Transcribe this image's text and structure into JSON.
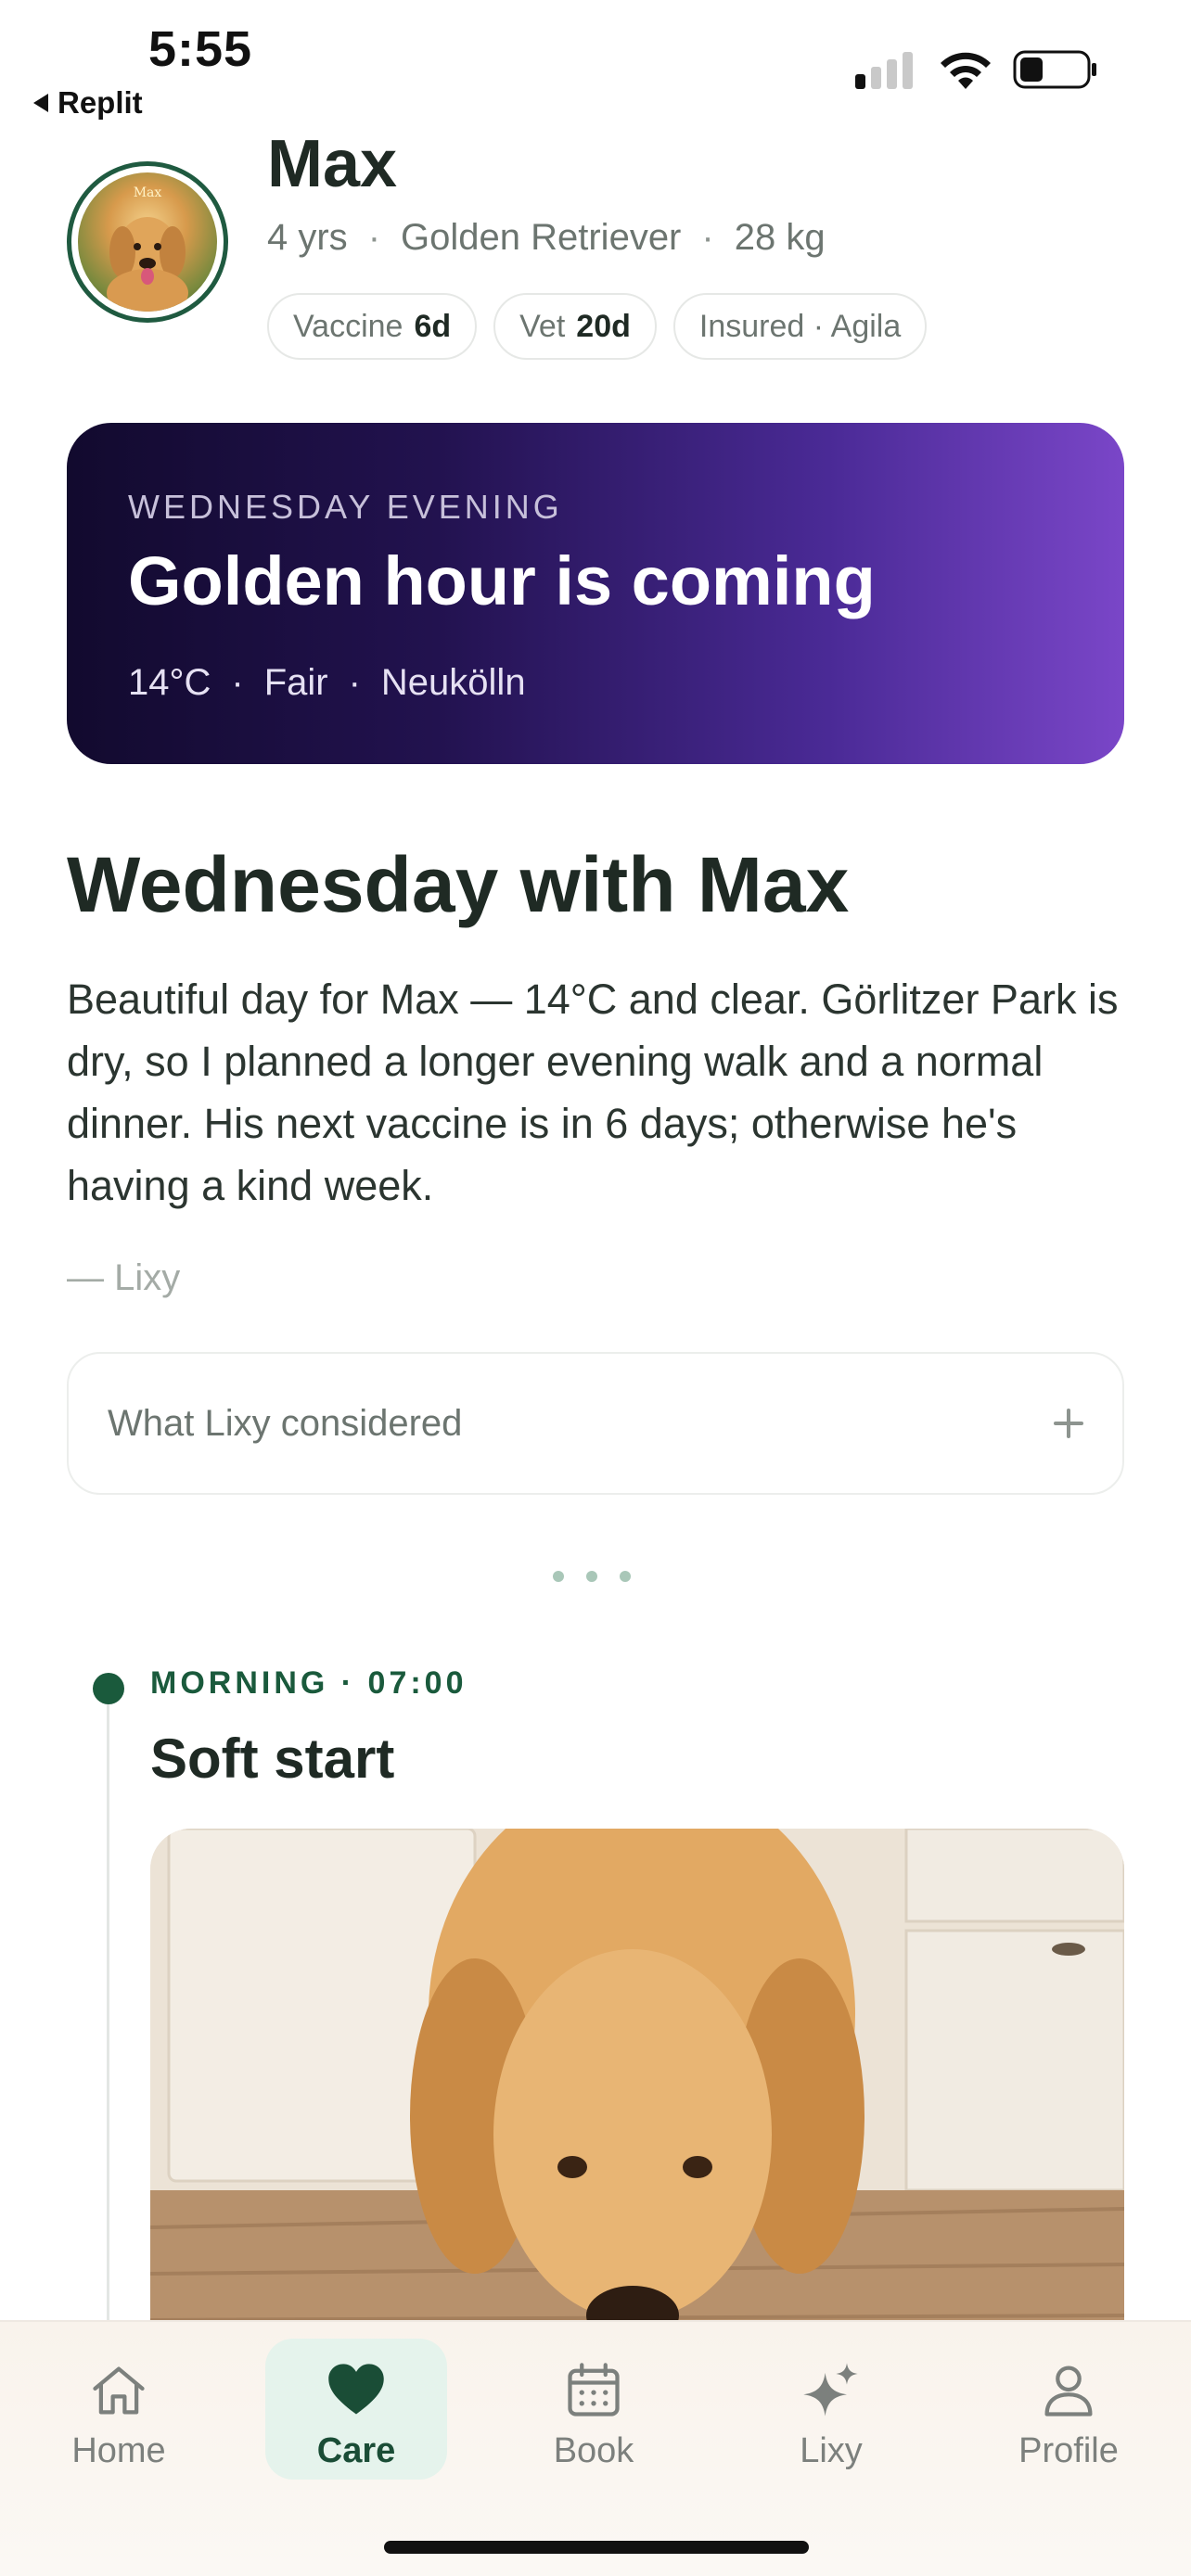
{
  "status_bar": {
    "time": "5:55",
    "back_app": "Replit",
    "signal_bars_active": 1,
    "battery_level": 0.35
  },
  "pet": {
    "name": "Max",
    "avatar_caption": "Max",
    "age": "4 yrs",
    "breed": "Golden Retriever",
    "weight": "28 kg",
    "separator": "·"
  },
  "chips": [
    {
      "label": "Vaccine",
      "value": "6d"
    },
    {
      "label": "Vet",
      "value": "20d"
    },
    {
      "label": "Insured · Agila",
      "value": ""
    }
  ],
  "hero": {
    "eyebrow": "WEDNESDAY EVENING",
    "title": "Golden hour is coming",
    "temperature": "14°C",
    "condition": "Fair",
    "location": "Neukölln",
    "separator": "·"
  },
  "day": {
    "title": "Wednesday with Max",
    "body": "Beautiful day for Max — 14°C and clear. Görlitzer Park is dry, so I planned a longer evening walk and a normal dinner. His next vaccine is in 6 days; otherwise he's having a kind week.",
    "signature": "— Lixy"
  },
  "considered": {
    "label": "What Lixy considered",
    "icon": "plus-icon"
  },
  "timeline": [
    {
      "eyebrow": "MORNING · 07:00",
      "title": "Soft start",
      "image": "dog-eating-photo"
    }
  ],
  "tabs": [
    {
      "label": "Home",
      "icon": "home-icon",
      "active": false
    },
    {
      "label": "Care",
      "icon": "heart-icon",
      "active": true
    },
    {
      "label": "Book",
      "icon": "calendar-icon",
      "active": false
    },
    {
      "label": "Lixy",
      "icon": "sparkle-icon",
      "active": false
    },
    {
      "label": "Profile",
      "icon": "person-icon",
      "active": false
    }
  ],
  "colors": {
    "accent_green": "#1a5a3c",
    "active_tab_bg": "#e5f3ec",
    "hero_gradient_start": "#120a2e",
    "hero_gradient_end": "#7a46c8"
  }
}
